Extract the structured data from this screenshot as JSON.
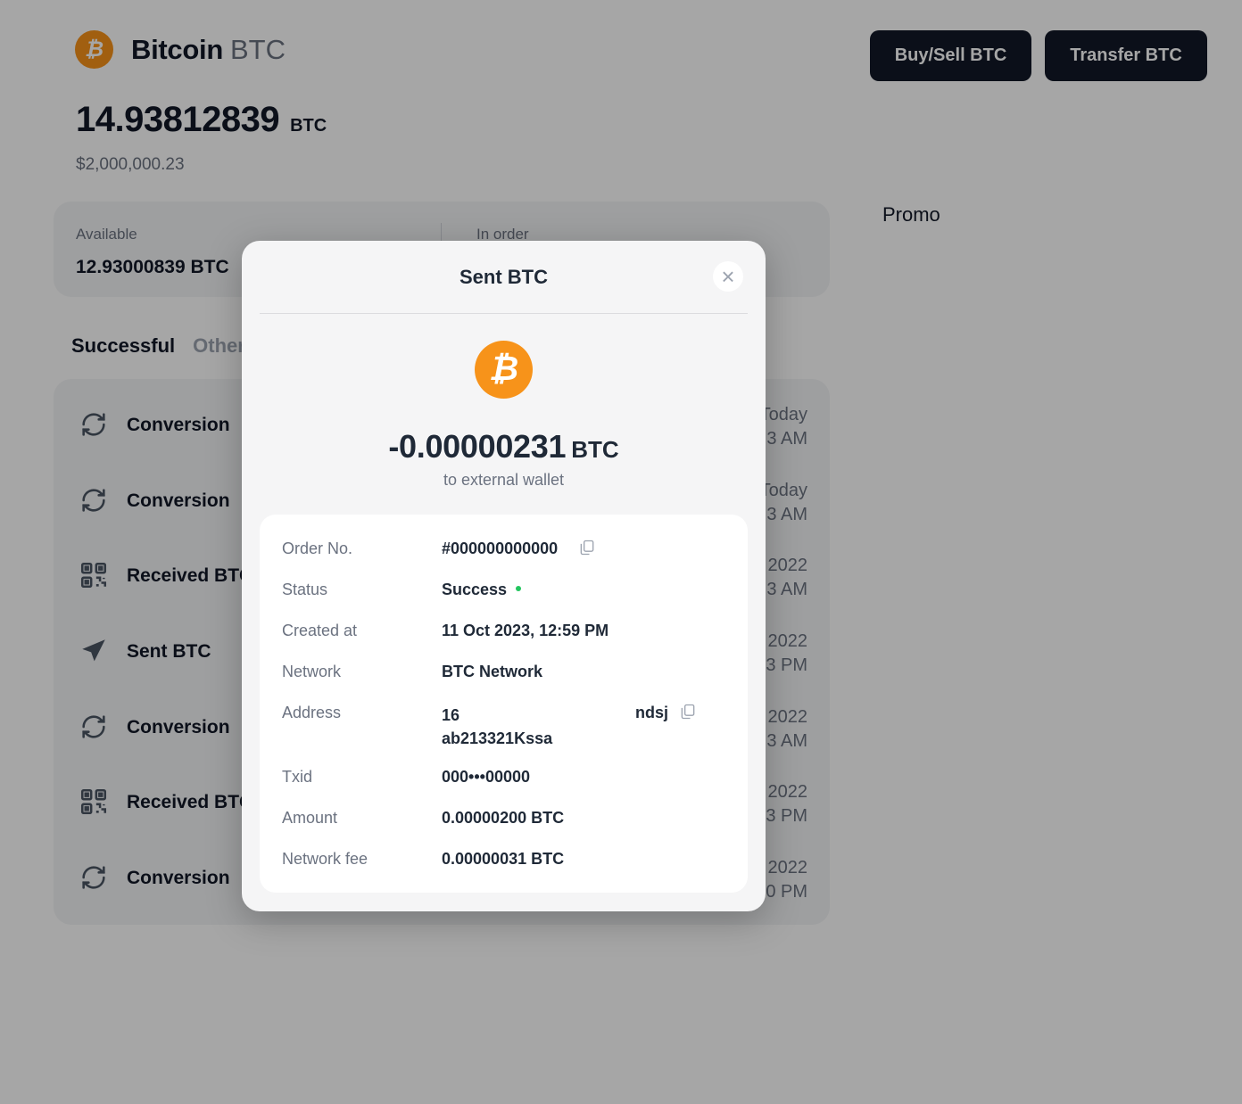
{
  "header": {
    "coin_name": "Bitcoin",
    "coin_ticker": "BTC",
    "buy_sell_label": "Buy/Sell BTC",
    "transfer_label": "Transfer BTC"
  },
  "balance": {
    "amount": "14.93812839",
    "unit": "BTC",
    "fiat": "$2,000,000.23"
  },
  "stats": {
    "available_label": "Available",
    "available_value": "12.93000839 BTC",
    "in_order_label": "In order"
  },
  "promo_label": "Promo",
  "tabs": {
    "successful": "Successful",
    "other": "Other"
  },
  "transactions": [
    {
      "label": "Conversion",
      "icon": "refresh-icon",
      "date_line1": "Today",
      "date_line2": "3 AM"
    },
    {
      "label": "Conversion",
      "icon": "refresh-icon",
      "date_line1": "Today",
      "date_line2": "3 AM"
    },
    {
      "label": "Received BTC",
      "icon": "qr-code-icon",
      "date_line1": "2022",
      "date_line2": "3 AM"
    },
    {
      "label": "Sent BTC",
      "icon": "send-icon",
      "date_line1": "2022",
      "date_line2": "3 PM"
    },
    {
      "label": "Conversion",
      "icon": "refresh-icon",
      "date_line1": "2022",
      "date_line2": "3 AM"
    },
    {
      "label": "Received BTC",
      "icon": "qr-code-icon",
      "date_line1": "2022",
      "date_line2": "3 PM"
    },
    {
      "label": "Conversion",
      "icon": "refresh-icon",
      "date_line1": "2022",
      "date_line2": "0 PM"
    }
  ],
  "modal": {
    "title": "Sent BTC",
    "amount": "-0.00000231",
    "unit": "BTC",
    "subtitle": "to external wallet",
    "details": {
      "order_label": "Order No.",
      "order_value": "#000000000000",
      "status_label": "Status",
      "status_value": "Success",
      "created_label": "Created at",
      "created_value": "11 Oct 2023, 12:59 PM",
      "network_label": "Network",
      "network_value": "BTC Network",
      "address_label": "Address",
      "address_line1": "16",
      "address_tail": "ndsj",
      "address_line2": "ab213321Kssa",
      "txid_label": "Txid",
      "txid_value": "000•••00000",
      "amount_label": "Amount",
      "amount_value": "0.00000200 BTC",
      "fee_label": "Network fee",
      "fee_value": "0.00000031 BTC"
    }
  },
  "colors": {
    "bitcoin_orange": "#f7931a",
    "dark_button": "#111827",
    "success_green": "#22c55e"
  }
}
